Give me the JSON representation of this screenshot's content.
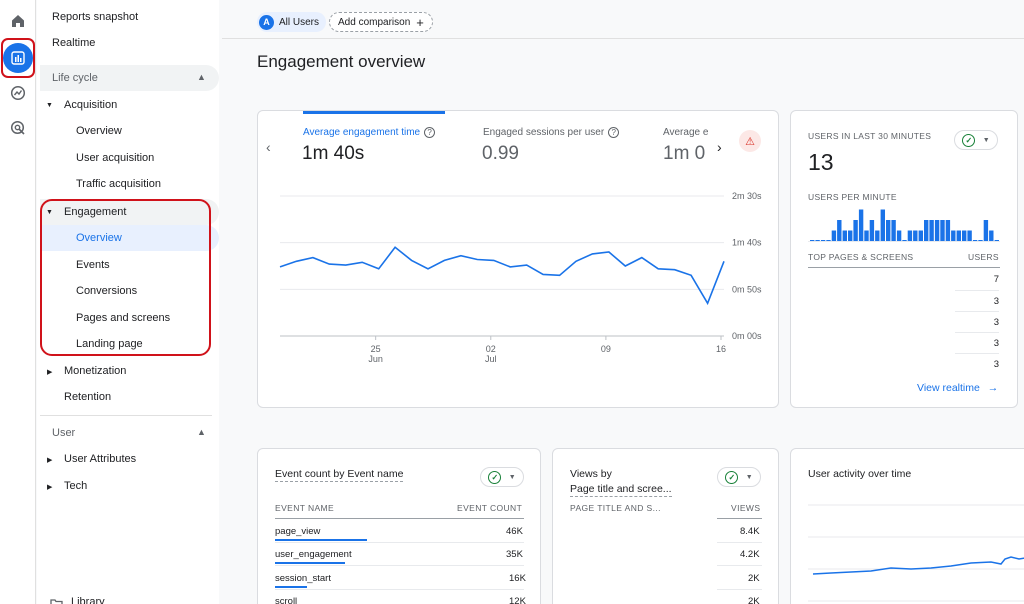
{
  "colors": {
    "accent": "#1a73e8",
    "highlight_red": "#d0121a",
    "success": "#188038",
    "warning": "#d93025"
  },
  "rail": {
    "icons": [
      "home-icon",
      "reports-icon",
      "explore-icon",
      "advertising-icon"
    ]
  },
  "sidebar": {
    "reports_snapshot": "Reports snapshot",
    "realtime": "Realtime",
    "lifecycle": "Life cycle",
    "acquisition": "Acquisition",
    "acquisition_items": [
      "Overview",
      "User acquisition",
      "Traffic acquisition"
    ],
    "engagement": "Engagement",
    "engagement_items": [
      "Overview",
      "Events",
      "Conversions",
      "Pages and screens",
      "Landing page"
    ],
    "monetization": "Monetization",
    "retention": "Retention",
    "user_section": "User",
    "user_attributes": "User Attributes",
    "tech": "Tech",
    "library": "Library"
  },
  "filters": {
    "badge": "A",
    "all_users": "All Users",
    "add_comparison": "Add comparison",
    "add_icon": "+"
  },
  "page_title": "Engagement overview",
  "engagement_card": {
    "metrics": [
      {
        "label": "Average engagement time",
        "value": "1m 40s"
      },
      {
        "label": "Engaged sessions per user",
        "value": "0.99"
      },
      {
        "label": "Average e",
        "value": "1m 0"
      }
    ],
    "info_icon": "?",
    "warn_icon": "⚠",
    "prev_icon": "‹",
    "next_icon": "›"
  },
  "chart_data": {
    "type": "line",
    "x_ticks": [
      {
        "day": "25",
        "month": "Jun"
      },
      {
        "day": "02",
        "month": "Jul"
      },
      {
        "day": "09",
        "month": ""
      },
      {
        "day": "16",
        "month": ""
      }
    ],
    "y_ticks": [
      "2m 30s",
      "1m 40s",
      "0m 50s",
      "0m 00s"
    ],
    "ylim": [
      0,
      150
    ],
    "y_unit": "seconds",
    "series": [
      {
        "values": [
          74,
          80,
          84,
          77,
          76,
          79,
          72,
          95,
          81,
          72,
          81,
          86,
          82,
          81,
          74,
          76,
          66,
          65,
          80,
          88,
          90,
          75,
          84,
          72,
          71,
          65,
          35,
          80
        ]
      }
    ]
  },
  "realtime_card": {
    "title": "USERS IN LAST 30 MINUTES",
    "count": "13",
    "per_minute_label": "USERS PER MINUTE",
    "per_minute": [
      0,
      0,
      0,
      0,
      1,
      2,
      1,
      1,
      2,
      3,
      1,
      2,
      1,
      3,
      2,
      2,
      1,
      0,
      1,
      1,
      1,
      2,
      2,
      2,
      2,
      2,
      1,
      1,
      1,
      1,
      0,
      0,
      2,
      1,
      0
    ],
    "top_pages_label": "TOP PAGES & SCREENS",
    "users_label": "USERS",
    "rows": [
      "7",
      "3",
      "3",
      "3",
      "3"
    ],
    "view_realtime": "View realtime",
    "arrow": "→"
  },
  "event_card": {
    "title": "Event count by Event name",
    "col1": "EVENT NAME",
    "col2": "EVENT COUNT",
    "rows": [
      {
        "name": "page_view",
        "count": "46K",
        "share": 1.0
      },
      {
        "name": "user_engagement",
        "count": "35K",
        "share": 0.76
      },
      {
        "name": "session_start",
        "count": "16K",
        "share": 0.35
      },
      {
        "name": "scroll",
        "count": "12K",
        "share": 0.26
      }
    ]
  },
  "views_card": {
    "title_line1": "Views by",
    "title_line2": "Page title and scree...",
    "col1": "PAGE TITLE AND S...",
    "col2": "VIEWS",
    "rows": [
      "8.4K",
      "4.2K",
      "2K",
      "2K"
    ]
  },
  "activity_card": {
    "title": "User activity over time"
  }
}
